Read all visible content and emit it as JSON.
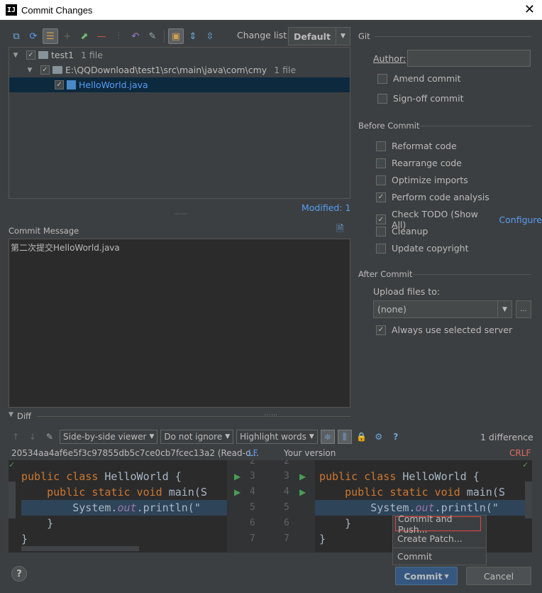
{
  "window": {
    "title": "Commit Changes",
    "app_icon": "IJ"
  },
  "toolbar": {
    "changelist_label": "Change list:",
    "changelist_value": "Default",
    "icons": [
      "show-diff-icon",
      "refresh-icon",
      "group-by-icon",
      "add-icon",
      "move-icon",
      "remove-icon",
      "diff-split-icon",
      "revert-icon",
      "edit-icon",
      "expand-selected-icon",
      "expand-all-icon",
      "collapse-all-icon"
    ]
  },
  "tree": {
    "rows": [
      {
        "name": "test1",
        "meta": "1 file"
      },
      {
        "name": "E:\\QQDownload\\test1\\src\\main\\java\\com\\cmy",
        "meta": "1 file"
      },
      {
        "name": "HelloWorld.java",
        "meta": ""
      }
    ],
    "modified_label": "Modified: 1"
  },
  "commit_message": {
    "label": "Commit Message",
    "text": "第二次提交HelloWorld.java"
  },
  "git": {
    "title": "Git",
    "author_label": "Author:",
    "author_value": "",
    "amend_label": "Amend commit",
    "signoff_label": "Sign-off commit"
  },
  "before_commit": {
    "title": "Before Commit",
    "options": [
      {
        "label": "Reformat code",
        "checked": false
      },
      {
        "label": "Rearrange code",
        "checked": false
      },
      {
        "label": "Optimize imports",
        "checked": false
      },
      {
        "label": "Perform code analysis",
        "checked": true
      },
      {
        "label": "Check TODO (Show All)",
        "checked": true
      },
      {
        "label": "Cleanup",
        "checked": false
      },
      {
        "label": "Update copyright",
        "checked": false
      }
    ],
    "configure_link": "Configure"
  },
  "after_commit": {
    "title": "After Commit",
    "upload_label": "Upload files to:",
    "upload_value": "(none)",
    "ellipsis": "...",
    "always_label": "Always use selected server"
  },
  "diff": {
    "title": "Diff",
    "viewer": "Side-by-side viewer",
    "ignore": "Do not ignore",
    "highlight": "Highlight words",
    "differences": "1 difference",
    "left_header": "20534aa4af6e5f3c97855db5c7ce0cb7fcec13a2 (Read-o...",
    "left_lineending": "LF",
    "right_header": "Your version",
    "right_lineending": "CRLF",
    "line_numbers_left": [
      "2",
      "3",
      "4",
      "5",
      "6",
      "7"
    ],
    "line_numbers_right": [
      "2",
      "3",
      "4",
      "5",
      "6",
      "7"
    ]
  },
  "popup": {
    "items": [
      "Commit and Push...",
      "Create Patch...",
      "Commit"
    ]
  },
  "buttons": {
    "commit": "Commit",
    "cancel": "Cancel",
    "help": "?"
  },
  "colors": {
    "background": "#3c3f41",
    "editor": "#2b2b2b",
    "link": "#589df6",
    "keyword": "#cc7832",
    "highlight_border": "#e04646",
    "commit_button": "#365880"
  }
}
